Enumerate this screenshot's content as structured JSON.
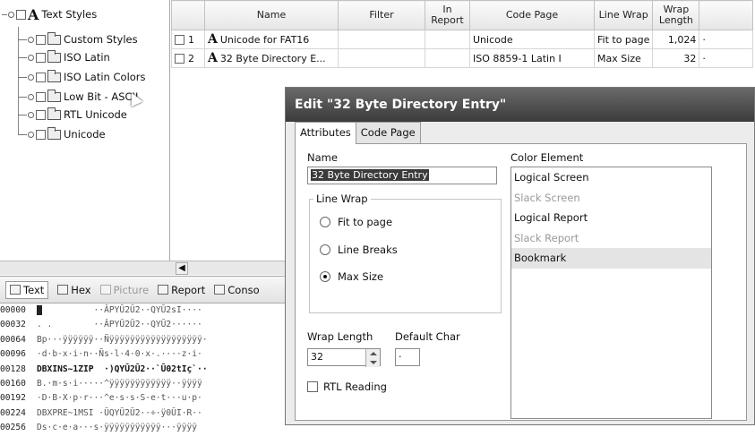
{
  "tree": {
    "root_label": "Text Styles",
    "items": [
      {
        "label": "Custom Styles"
      },
      {
        "label": "ISO Latin"
      },
      {
        "label": "ISO Latin Colors"
      },
      {
        "label": "Low Bit - ASCII"
      },
      {
        "label": "RTL Unicode"
      },
      {
        "label": "Unicode"
      }
    ]
  },
  "grid": {
    "columns": [
      "Name",
      "Filter",
      "In Report",
      "Code Page",
      "Line Wrap",
      "Wrap Length"
    ],
    "rows": [
      {
        "index": "1",
        "name": "Unicode for FAT16",
        "filter": "",
        "in_report": "",
        "code_page": "Unicode",
        "line_wrap": "Fit to page",
        "wrap_length": "1,024",
        "trail": "·"
      },
      {
        "index": "2",
        "name": "32 Byte Directory E...",
        "filter": "",
        "in_report": "",
        "code_page": "ISO 8859-1 Latin I",
        "line_wrap": "Max Size",
        "wrap_length": "32",
        "trail": "·"
      }
    ]
  },
  "bottom_tabs": [
    {
      "label": "Text",
      "icon": "text-icon",
      "state": "active"
    },
    {
      "label": "Hex",
      "icon": "hex-icon",
      "state": "normal"
    },
    {
      "label": "Picture",
      "icon": "picture-icon",
      "state": "disabled"
    },
    {
      "label": "Report",
      "icon": "report-icon",
      "state": "normal"
    },
    {
      "label": "Conso",
      "icon": "console-icon",
      "state": "normal"
    }
  ],
  "hex_rows": [
    {
      "addr": "00000",
      "data": "          ··ÂPYŪ2Ū2··QYŪ2sI····"
    },
    {
      "addr": "00032",
      "data": ". .        ··ÂPYŪ2Ū2··QYŪ2······"
    },
    {
      "addr": "00064",
      "data": "Bp···ÿÿÿÿÿÿ··Ñÿÿÿÿÿÿÿÿÿÿÿÿÿÿÿÿÿÿ·"
    },
    {
      "addr": "00096",
      "data": "·d·b·x·i·n··Ñs·l·4·0·x·.····z·i·"
    },
    {
      "addr": "00128",
      "data": "DBXINS~1ZIP  ·)QYŪ2Ū2··`Ū02tIç`··"
    },
    {
      "addr": "00160",
      "data": "B.·m·s·i·····^ÿÿÿÿÿÿÿÿÿÿÿÿ··ÿÿÿÿ"
    },
    {
      "addr": "00192",
      "data": "·D·B·X·p·r···^e·s·s·S·e·t···u·p·"
    },
    {
      "addr": "00224",
      "data": "DBXPRE~1MSI ·ŪQYŪ2Ū2··÷·ÿ0ŪI·R··"
    },
    {
      "addr": "00256",
      "data": "Ds·c·e·a···s·ÿÿÿÿÿÿÿÿÿÿÿ···ÿÿÿÿ"
    }
  ],
  "dialog": {
    "title": "Edit \"32 Byte Directory Entry\"",
    "tabs": [
      "Attributes",
      "Code Page"
    ],
    "name_label": "Name",
    "name_value": "32 Byte Directory Entry",
    "line_wrap_label": "Line Wrap",
    "line_wrap_options": [
      {
        "label": "Fit to page",
        "checked": false
      },
      {
        "label": "Line Breaks",
        "checked": false
      },
      {
        "label": "Max Size",
        "checked": true
      }
    ],
    "wrap_length_label": "Wrap Length",
    "wrap_length_value": "32",
    "default_char_label": "Default Char",
    "default_char_value": "·",
    "rtl_label": "RTL Reading",
    "rtl_checked": false,
    "color_element_label": "Color Element",
    "color_elements": [
      {
        "label": "Logical Screen",
        "state": "normal"
      },
      {
        "label": "Slack Screen",
        "state": "dim"
      },
      {
        "label": "Logical Report",
        "state": "normal"
      },
      {
        "label": "Slack Report",
        "state": "dim"
      },
      {
        "label": "Bookmark",
        "state": "highlighted"
      }
    ]
  }
}
